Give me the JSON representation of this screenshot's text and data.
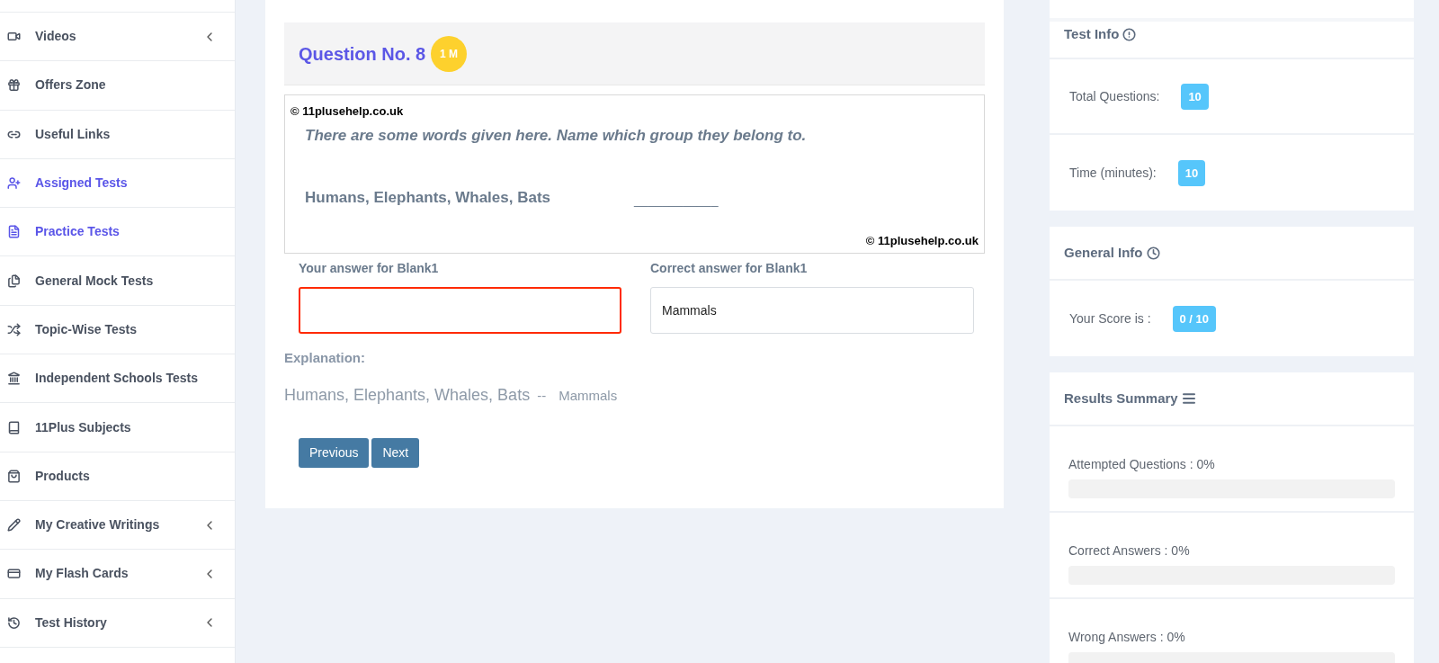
{
  "sidebar": {
    "items": [
      {
        "label": "Videos",
        "highlighted": false,
        "expandable": true
      },
      {
        "label": "Offers Zone",
        "highlighted": false,
        "expandable": false
      },
      {
        "label": "Useful Links",
        "highlighted": false,
        "expandable": false
      },
      {
        "label": "Assigned Tests",
        "highlighted": true,
        "expandable": false
      },
      {
        "label": "Practice Tests",
        "highlighted": true,
        "expandable": false
      },
      {
        "label": "General Mock Tests",
        "highlighted": false,
        "expandable": false
      },
      {
        "label": "Topic-Wise Tests",
        "highlighted": false,
        "expandable": false
      },
      {
        "label": "Independent Schools Tests",
        "highlighted": false,
        "expandable": false
      },
      {
        "label": "11Plus Subjects",
        "highlighted": false,
        "expandable": false
      },
      {
        "label": "Products",
        "highlighted": false,
        "expandable": false
      },
      {
        "label": "My Creative Writings",
        "highlighted": false,
        "expandable": true
      },
      {
        "label": "My Flash Cards",
        "highlighted": false,
        "expandable": true
      },
      {
        "label": "Test History",
        "highlighted": false,
        "expandable": true
      }
    ]
  },
  "question": {
    "title": "Question No. 8",
    "marks": "1 M",
    "copyright_top": "© 11plusehelp.co.uk",
    "instruction": "There are some words given here. Name which group they belong to.",
    "words": "Humans, Elephants, Whales, Bats",
    "blank": "____________",
    "copyright_bottom": "© 11plusehelp.co.uk",
    "your_answer_label": "Your answer for Blank1",
    "your_answer_correct": false,
    "correct_answer_label": "Correct answer for Blank1",
    "correct_answer": "Mammals",
    "explanation_label": "Explanation:",
    "explanation_words": "Humans, Elephants, Whales, Bats",
    "explanation_sep": "--",
    "explanation_answer": "Mammals",
    "buttons": [
      "Previous",
      "Next"
    ]
  },
  "test_info": {
    "title": "Test Info",
    "rows": [
      {
        "label": "Total Questions:",
        "value": "10"
      },
      {
        "label": "Time (minutes):",
        "value": "10"
      }
    ]
  },
  "general_info": {
    "title": "General Info",
    "rows": [
      {
        "label": "Your Score is :",
        "value": "0 / 10"
      }
    ]
  },
  "results_summary": {
    "title": "Results Summary",
    "rows": [
      {
        "label": "Attempted Questions : 0%",
        "level": 0
      },
      {
        "label": "Correct Answers : 0%",
        "level": 0
      },
      {
        "label": "Wrong Answers : 0%",
        "level": 0
      }
    ]
  }
}
